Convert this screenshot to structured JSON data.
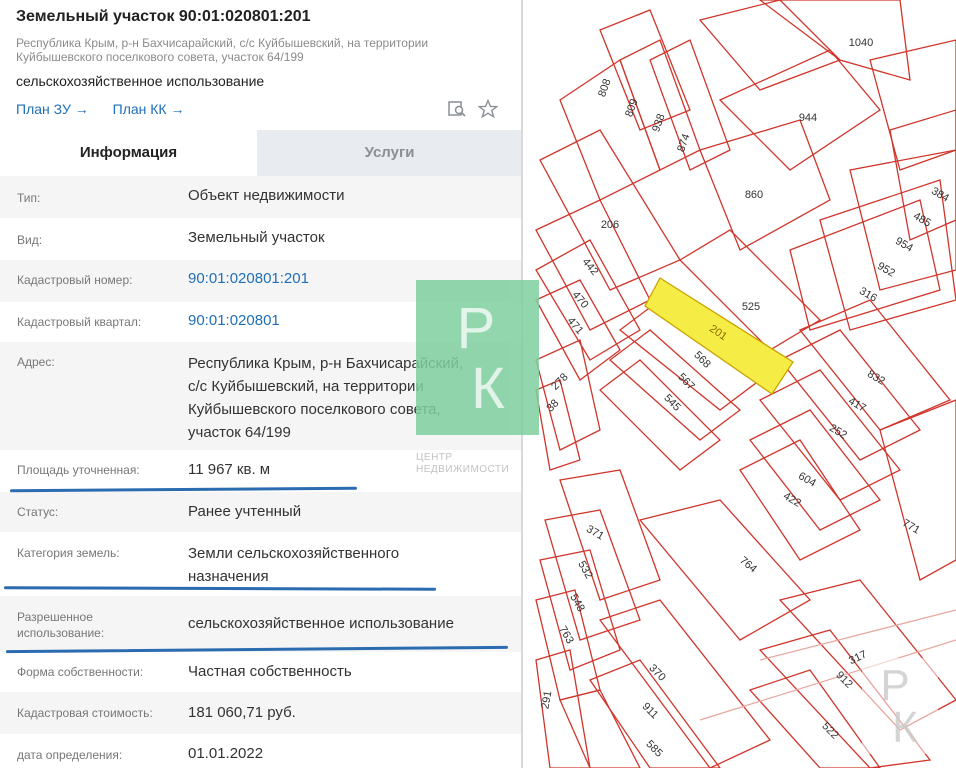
{
  "header": {
    "title": "Земельный участок 90:01:020801:201",
    "address": "Республика Крым, р-н Бахчисарайский, с/с Куйбышевский, на территории Куйбышевского поселкового совета, участок 64/199",
    "usage": "сельскохозяйственное использование",
    "links": [
      "План ЗУ →",
      "План КК →"
    ],
    "icons": [
      "search-map-icon",
      "star-icon"
    ]
  },
  "tabs": [
    {
      "label": "Информация",
      "active": true
    },
    {
      "label": "Услуги",
      "active": false
    }
  ],
  "info": [
    {
      "label": "Тип:",
      "value": "Объект недвижимости"
    },
    {
      "label": "Вид:",
      "value": "Земельный участок"
    },
    {
      "label": "Кадастровый номер:",
      "value": "90:01:020801:201",
      "link": true
    },
    {
      "label": "Кадастровый квартал:",
      "value": "90:01:020801",
      "link": true
    },
    {
      "label": "Адрес:",
      "value_lines": [
        "Республика Крым, р-н Бахчисарайский,",
        "с/с Куйбышевский, на территории",
        "Куйбышевского поселкового совета,",
        "участок 64/199"
      ]
    },
    {
      "label": "Площадь уточненная:",
      "value": "11 967 кв. м"
    },
    {
      "label": "Статус:",
      "value": "Ранее учтенный"
    },
    {
      "label": "Категория земель:",
      "value_lines": [
        "Земли сельскохозяйственного",
        "назначения"
      ]
    },
    {
      "label_lines": [
        "Разрешенное",
        "использование:"
      ],
      "value": "сельскохозяйственное использование"
    },
    {
      "label": "Форма собственности:",
      "value": "Частная собственность"
    },
    {
      "label": "Кадастровая стоимость:",
      "value": "181 060,71 руб."
    },
    {
      "label": "дата определения:",
      "value": "01.01.2022"
    }
  ],
  "watermark": {
    "monogram": [
      "Р",
      "К"
    ],
    "text_lines": [
      "ЦЕНТР",
      "НЕДВИЖИМОСТИ"
    ]
  },
  "map": {
    "parcel_labels": [
      "1040",
      "808",
      "809",
      "938",
      "874",
      "944",
      "860",
      "384",
      "485",
      "954",
      "952",
      "316",
      "206",
      "442",
      "470",
      "471",
      "278",
      "38",
      "525",
      "201",
      "568",
      "567",
      "545",
      "832",
      "417",
      "252",
      "604",
      "422",
      "771",
      "371",
      "532",
      "548",
      "763",
      "764",
      "370",
      "911",
      "585",
      "317",
      "912",
      "522",
      "291"
    ],
    "highlight_parcel": "201",
    "colors": {
      "boundary": "#d0352b",
      "highlight_fill": "#f5ec45",
      "highlight_stroke": "#c9a400",
      "label": "#333333"
    }
  },
  "colors": {
    "accent": "#1f6fb8",
    "underline": "#2b6cb0",
    "tab_inactive_bg": "#e8ebef",
    "row_shade": "#f5f5f5"
  }
}
